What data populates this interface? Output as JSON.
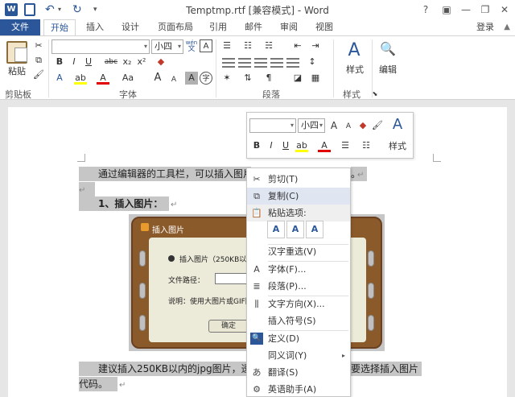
{
  "titlebar": {
    "app_icon": "W",
    "title": "Temptmp.rtf [兼容模式] - Word",
    "help": "?",
    "ribbon_options": "▣",
    "minimize": "—",
    "restore": "❐",
    "close": "✕"
  },
  "tabs": {
    "file": "文件",
    "items": [
      "开始",
      "插入",
      "设计",
      "页面布局",
      "引用",
      "邮件",
      "审阅",
      "视图"
    ],
    "active": "开始",
    "login": "登录",
    "login_arrow": "▲"
  },
  "ribbon": {
    "clipboard": {
      "paste": "粘贴",
      "label": "剪贴板"
    },
    "font": {
      "font_name": "",
      "font_size": "小四",
      "wen": "wén",
      "wen_char": "文",
      "border_char": "A",
      "bold": "B",
      "italic": "I",
      "underline": "U",
      "strike": "abc",
      "sub": "x₂",
      "sup": "x²",
      "grow": "A",
      "shrink": "A",
      "case": "Aa",
      "clear": "A",
      "shade_char": "A",
      "circle_char": "字",
      "label": "字体"
    },
    "paragraph": {
      "label": "段落"
    },
    "styles": {
      "button": "样式",
      "label": "样式"
    },
    "editing": {
      "button": "编辑"
    }
  },
  "document": {
    "line1": "通过编辑器的工具栏，可以插入图片",
    "line1_tail": "。",
    "heading": "1、插入图片：",
    "line3": "建议插入250KB以内的jpg图片，透",
    "line3_tail": "要选择插入图片",
    "line4": "代码。",
    "para_mark": "↵"
  },
  "picture": {
    "title": "插入图片",
    "option": "插入图片（250KB以内",
    "path_label": "文件路径：",
    "note": "说明：使用大图片或GIF图",
    "ok": "确定"
  },
  "mini_toolbar": {
    "font_name": "",
    "font_size": "小四",
    "bold": "B",
    "italic": "I",
    "underline": "U",
    "styles": "样式"
  },
  "context_menu": {
    "items": [
      {
        "icon": "scissors-icon",
        "glyph": "✂",
        "label": "剪切(T)"
      },
      {
        "icon": "copy-icon",
        "glyph": "⧉",
        "label": "复制(C)"
      },
      {
        "icon": "paste-options-icon",
        "glyph": "📋",
        "label": "粘贴选项:"
      },
      {
        "icon": "none",
        "glyph": "",
        "label": "汉字重选(V)"
      },
      {
        "icon": "font-icon",
        "glyph": "A",
        "label": "字体(F)..."
      },
      {
        "icon": "paragraph-icon",
        "glyph": "≣",
        "label": "段落(P)..."
      },
      {
        "icon": "text-direction-icon",
        "glyph": "⫼",
        "label": "文字方向(X)..."
      },
      {
        "icon": "none",
        "glyph": "",
        "label": "插入符号(S)"
      },
      {
        "icon": "define-icon",
        "glyph": "🔍",
        "label": "定义(D)"
      },
      {
        "icon": "none",
        "glyph": "",
        "label": "同义词(Y)"
      },
      {
        "icon": "translate-icon",
        "glyph": "あ",
        "label": "翻译(S)"
      },
      {
        "icon": "assistant-icon",
        "glyph": "⚙",
        "label": "英语助手(A)"
      }
    ],
    "paste_opts": [
      "A",
      "A",
      "A"
    ],
    "submenu_arrow": "▸"
  }
}
